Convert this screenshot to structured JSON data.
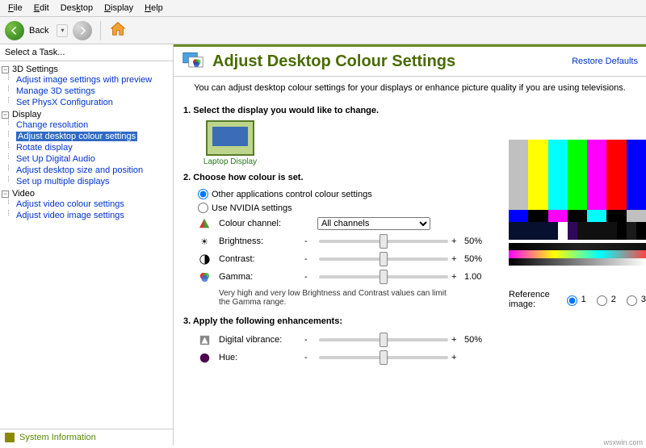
{
  "menu": [
    "File",
    "Edit",
    "Desktop",
    "Display",
    "Help"
  ],
  "toolbar": {
    "back": "Back"
  },
  "sidebar": {
    "title": "Select a Task...",
    "groups": [
      {
        "label": "3D Settings",
        "items": [
          "Adjust image settings with preview",
          "Manage 3D settings",
          "Set PhysX Configuration"
        ]
      },
      {
        "label": "Display",
        "items": [
          "Change resolution",
          "Adjust desktop colour settings",
          "Rotate display",
          "Set Up Digital Audio",
          "Adjust desktop size and position",
          "Set up multiple displays"
        ]
      },
      {
        "label": "Video",
        "items": [
          "Adjust video colour settings",
          "Adjust video image settings"
        ]
      }
    ],
    "selected": "Adjust desktop colour settings",
    "sysinfo": "System Information"
  },
  "main": {
    "title": "Adjust Desktop Colour Settings",
    "restore": "Restore Defaults",
    "subhead": "You can adjust desktop colour settings for your displays or enhance picture quality if you are using televisions.",
    "step1": "1. Select the display you would like to change.",
    "display_name": "Laptop Display",
    "step2": "2. Choose how colour is set.",
    "radio_other": "Other applications control colour settings",
    "radio_nvidia": "Use NVIDIA settings",
    "channel_label": "Colour channel:",
    "channel_sel": "All channels",
    "brightness_label": "Brightness:",
    "brightness_val": "50%",
    "contrast_label": "Contrast:",
    "contrast_val": "50%",
    "gamma_label": "Gamma:",
    "gamma_val": "1.00",
    "note": "Very high and very low Brightness and Contrast values can limit the Gamma range.",
    "step3": "3. Apply the following enhancements:",
    "dv_label": "Digital vibrance:",
    "dv_val": "50%",
    "hue_label": "Hue:",
    "refimg_label": "Reference image:",
    "refimg_opts": [
      "1",
      "2",
      "3"
    ]
  },
  "watermark": "wsxwin.com"
}
